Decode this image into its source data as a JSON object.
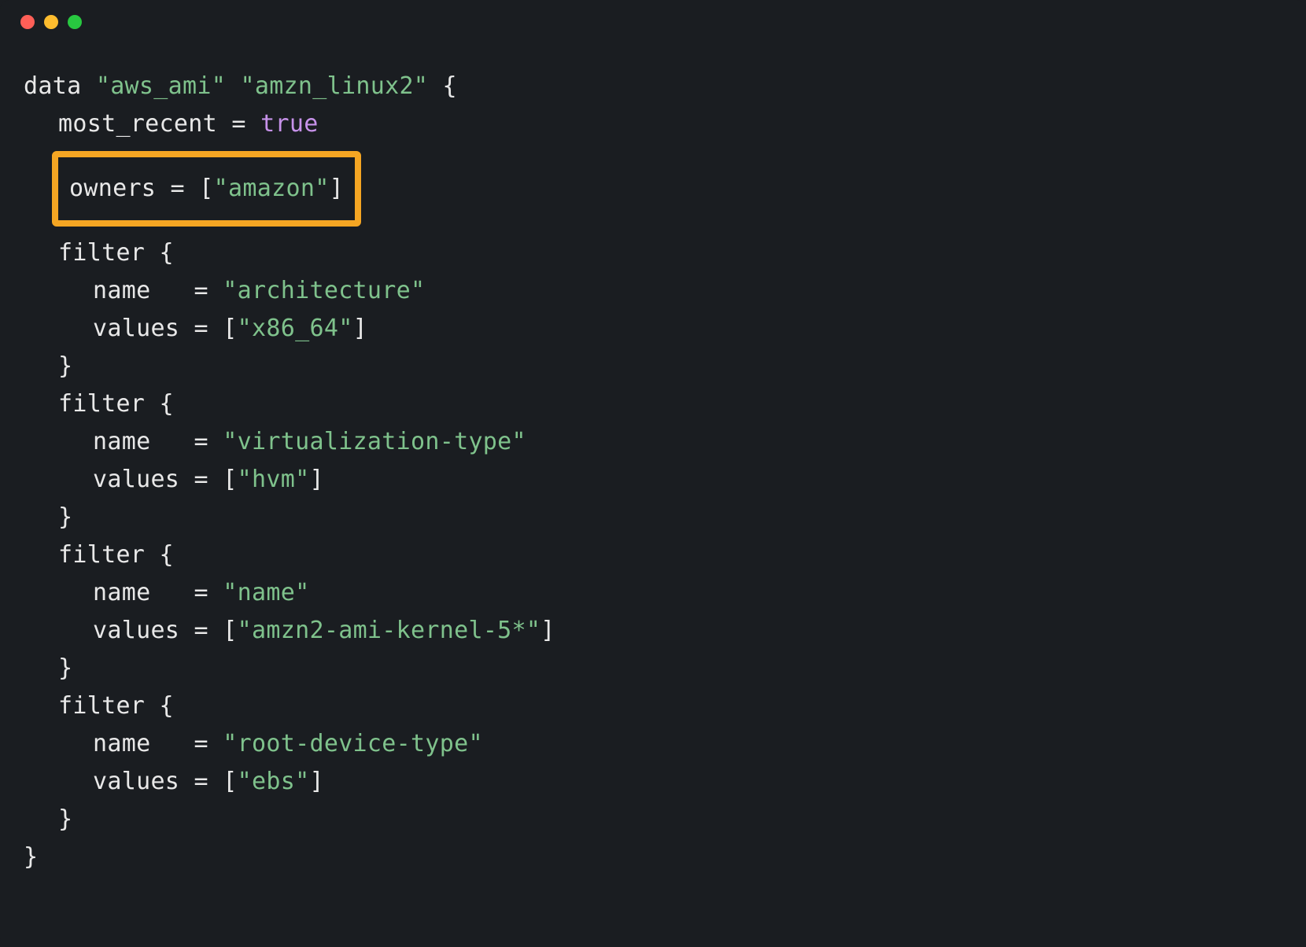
{
  "code": {
    "block_type": "data",
    "resource_type": "\"aws_ami\"",
    "resource_name": "\"amzn_linux2\"",
    "most_recent_key": "most_recent",
    "eq": "=",
    "most_recent_val": "true",
    "owners_key": "owners",
    "owners_open": "[",
    "owners_val": "\"amazon\"",
    "owners_close": "]",
    "filter_keyword": "filter",
    "brace_open": "{",
    "brace_close": "}",
    "name_key": "name",
    "values_key": "values",
    "filters": [
      {
        "name_val": "\"architecture\"",
        "values_val": "\"x86_64\""
      },
      {
        "name_val": "\"virtualization-type\"",
        "values_val": "\"hvm\""
      },
      {
        "name_val": "\"name\"",
        "values_val": "\"amzn2-ami-kernel-5*\""
      },
      {
        "name_val": "\"root-device-type\"",
        "values_val": "\"ebs\""
      }
    ]
  }
}
